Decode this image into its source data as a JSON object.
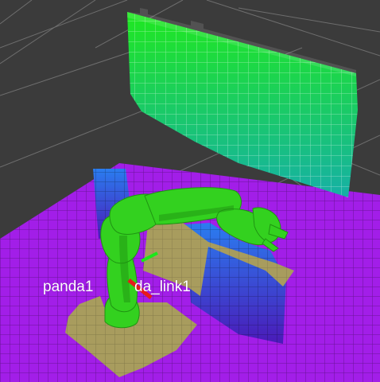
{
  "viewport": {
    "background_color": "#3b3b3b",
    "grid_line_color": "#6e6e6e"
  },
  "scene": {
    "floor_occupancy_color": "#a21ee8",
    "floor_occupancy_dark_color": "#7d16b8",
    "support_plane_color": "#a89c5e",
    "wall_top_color": "#1fe81f",
    "wall_bottom_color": "#16b0a6",
    "box_top_color": "#2a7df0",
    "box_bottom_color": "#4a1ab8",
    "robot_color": "#33d11f",
    "robot_shadow_color": "#1f9412",
    "axis_red": "#e81a1a",
    "axis_green": "#1ae81a"
  },
  "frame_labels": {
    "left": "panda1",
    "right": "da_link1"
  }
}
